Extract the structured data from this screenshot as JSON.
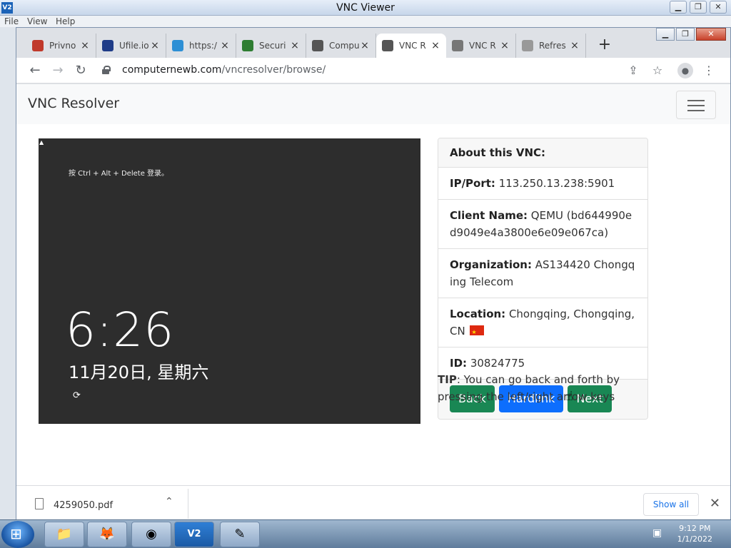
{
  "vnc_window": {
    "app_icon": "V2",
    "title": "VNC Viewer",
    "menu": [
      "File",
      "View",
      "Help"
    ],
    "controls": {
      "minimize": "▁",
      "restore": "❐",
      "close": "✕"
    }
  },
  "chrome": {
    "controls": {
      "minimize": "▁",
      "restore": "❐",
      "close": "✕"
    },
    "tabs": [
      {
        "label": "Privno",
        "icon": "privno-favicon",
        "color": "#c0392b"
      },
      {
        "label": "Ufile.io",
        "icon": "ufile-favicon",
        "color": "#1f3c88"
      },
      {
        "label": "https:/",
        "icon": "7i-favicon",
        "color": "#2d8fd5"
      },
      {
        "label": "Securi",
        "icon": "security-favicon",
        "color": "#2e7d32"
      },
      {
        "label": "Compu",
        "icon": "computer-favicon",
        "color": "#555555"
      },
      {
        "label": "VNC R",
        "icon": "vnc-favicon",
        "color": "#555555"
      },
      {
        "label": "VNC R",
        "icon": "loading-favicon",
        "color": "#777777"
      },
      {
        "label": "Refres",
        "icon": "refresh-favicon",
        "color": "#999999"
      }
    ],
    "active_tab": 5,
    "new_tab": "+",
    "url_domain": "computernewb.com",
    "url_path": "/vncresolver/browse/",
    "nav": {
      "back": "←",
      "forward": "→",
      "reload": "↻"
    },
    "toolbar_icons": {
      "share": "⇪",
      "bookmark": "☆",
      "profile": "●",
      "menu": "⋮"
    }
  },
  "page": {
    "brand": "VNC Resolver",
    "screen": {
      "hint": "按 Ctrl + Alt + Delete 登录。",
      "time": "6:26",
      "date": "11月20日, 星期六"
    },
    "card": {
      "header": "About this VNC:",
      "ip_label": "IP/Port:",
      "ip_value": "113.250.13.238:5901",
      "client_label": "Client Name:",
      "client_value": "QEMU (bd644990ed9049e4a3800e6e09e067ca)",
      "org_label": "Organization:",
      "org_value": "AS134420 Chongqing Telecom",
      "location_label": "Location:",
      "location_value": "Chongqing, Chongqing, CN",
      "id_label": "ID:",
      "id_value": "30824775",
      "buttons": {
        "back": "Back",
        "hardlink": "Hardlink",
        "next": "Next"
      }
    },
    "tip_label": "TIP",
    "tip_text": ": You can go back and forth by pressing the left/right arrow keys"
  },
  "downloads": {
    "file_name": "4259050.pdf",
    "show_all": "Show all",
    "close": "✕"
  },
  "taskbar": {
    "time": "9:12 PM",
    "date": "1/1/2022"
  },
  "colors": {
    "success": "#198754",
    "primary": "#0d6efd",
    "vnc_screen": "#2d2d2d"
  }
}
